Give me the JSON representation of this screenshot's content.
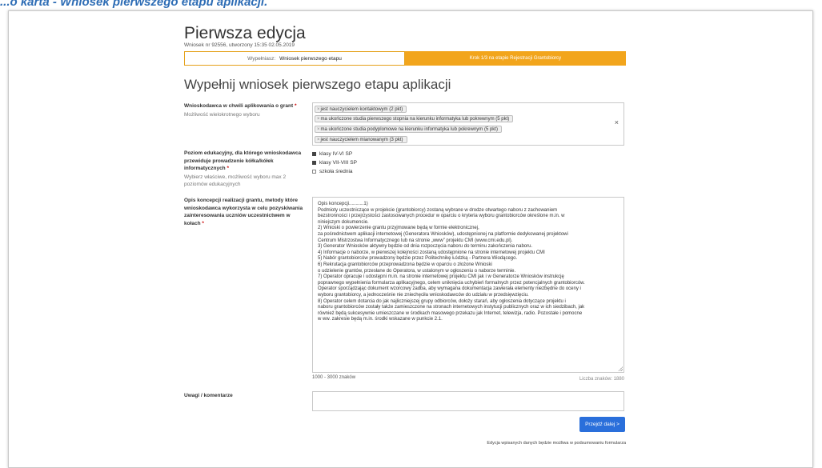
{
  "caption": "...o karta - Wniosek pierwszego etapu aplikacji.",
  "page": {
    "title": "Pierwsza edycja",
    "subtitle": "Wniosek nr 92556, utworzony 15:35 02.05.2019"
  },
  "steps": {
    "fill_label": "Wypełniasz:",
    "fill_value": "Wniosek pierwszego etapu",
    "next": "Krok 1/3 na etapie Rejestracji Grantobiorcy"
  },
  "heading": "Wypełnij wniosek pierwszego etapu aplikacji",
  "grant_field": {
    "label": "Wnioskodawca w chwili aplikowania o grant",
    "required": "*",
    "hint": "Możliwość wielokrotnego wyboru",
    "tags": [
      "jest nauczycielem kontaktowym (2 pkt)",
      "ma ukończone studia pierwszego stopnia na kierunku informatyka lub pokrewnym (5 pkt)",
      "ma ukończone studia podyplomowe na kierunku informatyka lub pokrewnym (5 pkt)",
      "jest nauczycielem mianowanym (3 pkt)"
    ],
    "tag_remove": "×",
    "clear": "×"
  },
  "education_field": {
    "label": "Poziom edukacyjny, dla którego wnioskodawca przewiduje prowadzenie kółka/kółek informatycznych",
    "required": "*",
    "hint": "Wybierz właściwe, możliwość wyboru max 2 poziomów edukacyjnych",
    "options": [
      {
        "label": "klasy IV-VI SP",
        "checked": true
      },
      {
        "label": "klasy VII-VIII SP",
        "checked": true
      },
      {
        "label": "szkoła średnia",
        "checked": false
      }
    ]
  },
  "concept_field": {
    "label": "Opis koncepcji realizacji grantu, metody które wnioskodawca wykorzysta w celu pozyskiwania zainteresowania uczniów uczestnictwem w kołach",
    "required": "*",
    "lines": [
      "Opis koncepcji...........1)",
      "Podmioty uczestniczące w projekcie (grantobiorcy) zostaną wybrane w drodze otwartego naboru z zachowaniem",
      "bezstronności i przejrzystości zastosowanych procedur w oparciu o kryteria wyboru grantobiorców określone m.in. w",
      "niniejszym dokumencie.",
      "2)     Wnioski o powierzenie grantu przyjmowane będą w formie elektronicznej,",
      "za pośrednictwem aplikacji internetowej (Generatora Wniosków), udostępnionej na platformie dedykowanej projektowi",
      "Centrum Mistrzostwa Informatycznego lub na stronie „www” projektu CMI (www.cmi.edu.pl).",
      "3)     Generator Wniosków aktywny będzie od dnia rozpoczęcia naboru do terminu zakończenia naboru.",
      "4)     Informacje o naborze, w pierwszej kolejności zostaną udostępnione na stronie internetowej projektu CMI",
      "5)     Nabór grantobiorców prowadzony będzie przez Politechnikę Łódzką - Partnera Wiodącego.",
      "6)     Rekrutacja grantobiorców przeprowadzona będzie w oparciu o złożone Wnioski",
      "o udzielenie grantów, przesłane do Operatora, w ustalonym w ogłoszeniu o naborze terminie.",
      "7)     Operator opracuje i udostępni m.in. na stronie internetowej projektu CMI jak i w Generatorze Wniosków instrukcję",
      "poprawnego wypełnienia formularza aplikacyjnego, celem uniknięcia uchybień formalnych przez potencjalnych grantobiorców.",
      "Operator sporządzając dokument wzorcowy zadba, aby wymagana dokumentacja zawierała elementy niezbędne do oceny i",
      "wyboru grantobiorcy, a jednocześnie nie zniechęciła wnioskodawców do udziału w przedsięwzięciu.",
      "8)     Operator celem dotarcia do jak najliczniejszej grupy odbiorców, dołoży starań, aby ogłoszenia dotyczące projektu i",
      "naboru grantobiorców zostały także zamieszczone na stronach internetowych instytucji publicznych oraz w ich siedzibach, jak",
      "również będą sukcesywnie umieszczane w środkach masowego przekazu jak Internet, telewizja, radio.  Pozostałe i pomocne",
      "w ww. zakresie będą m.in. środki wskazane w punkcie 2.1."
    ],
    "limit": "1000 - 3000 znaków",
    "count": "Liczba znaków: 1880"
  },
  "comments_field": {
    "label": "Uwagi / komentarze",
    "value": ""
  },
  "next_button": "Przejdź dalej >",
  "footer_note": "Edycja wpisanych danych będzie możliwa w podsumowaniu formularza"
}
